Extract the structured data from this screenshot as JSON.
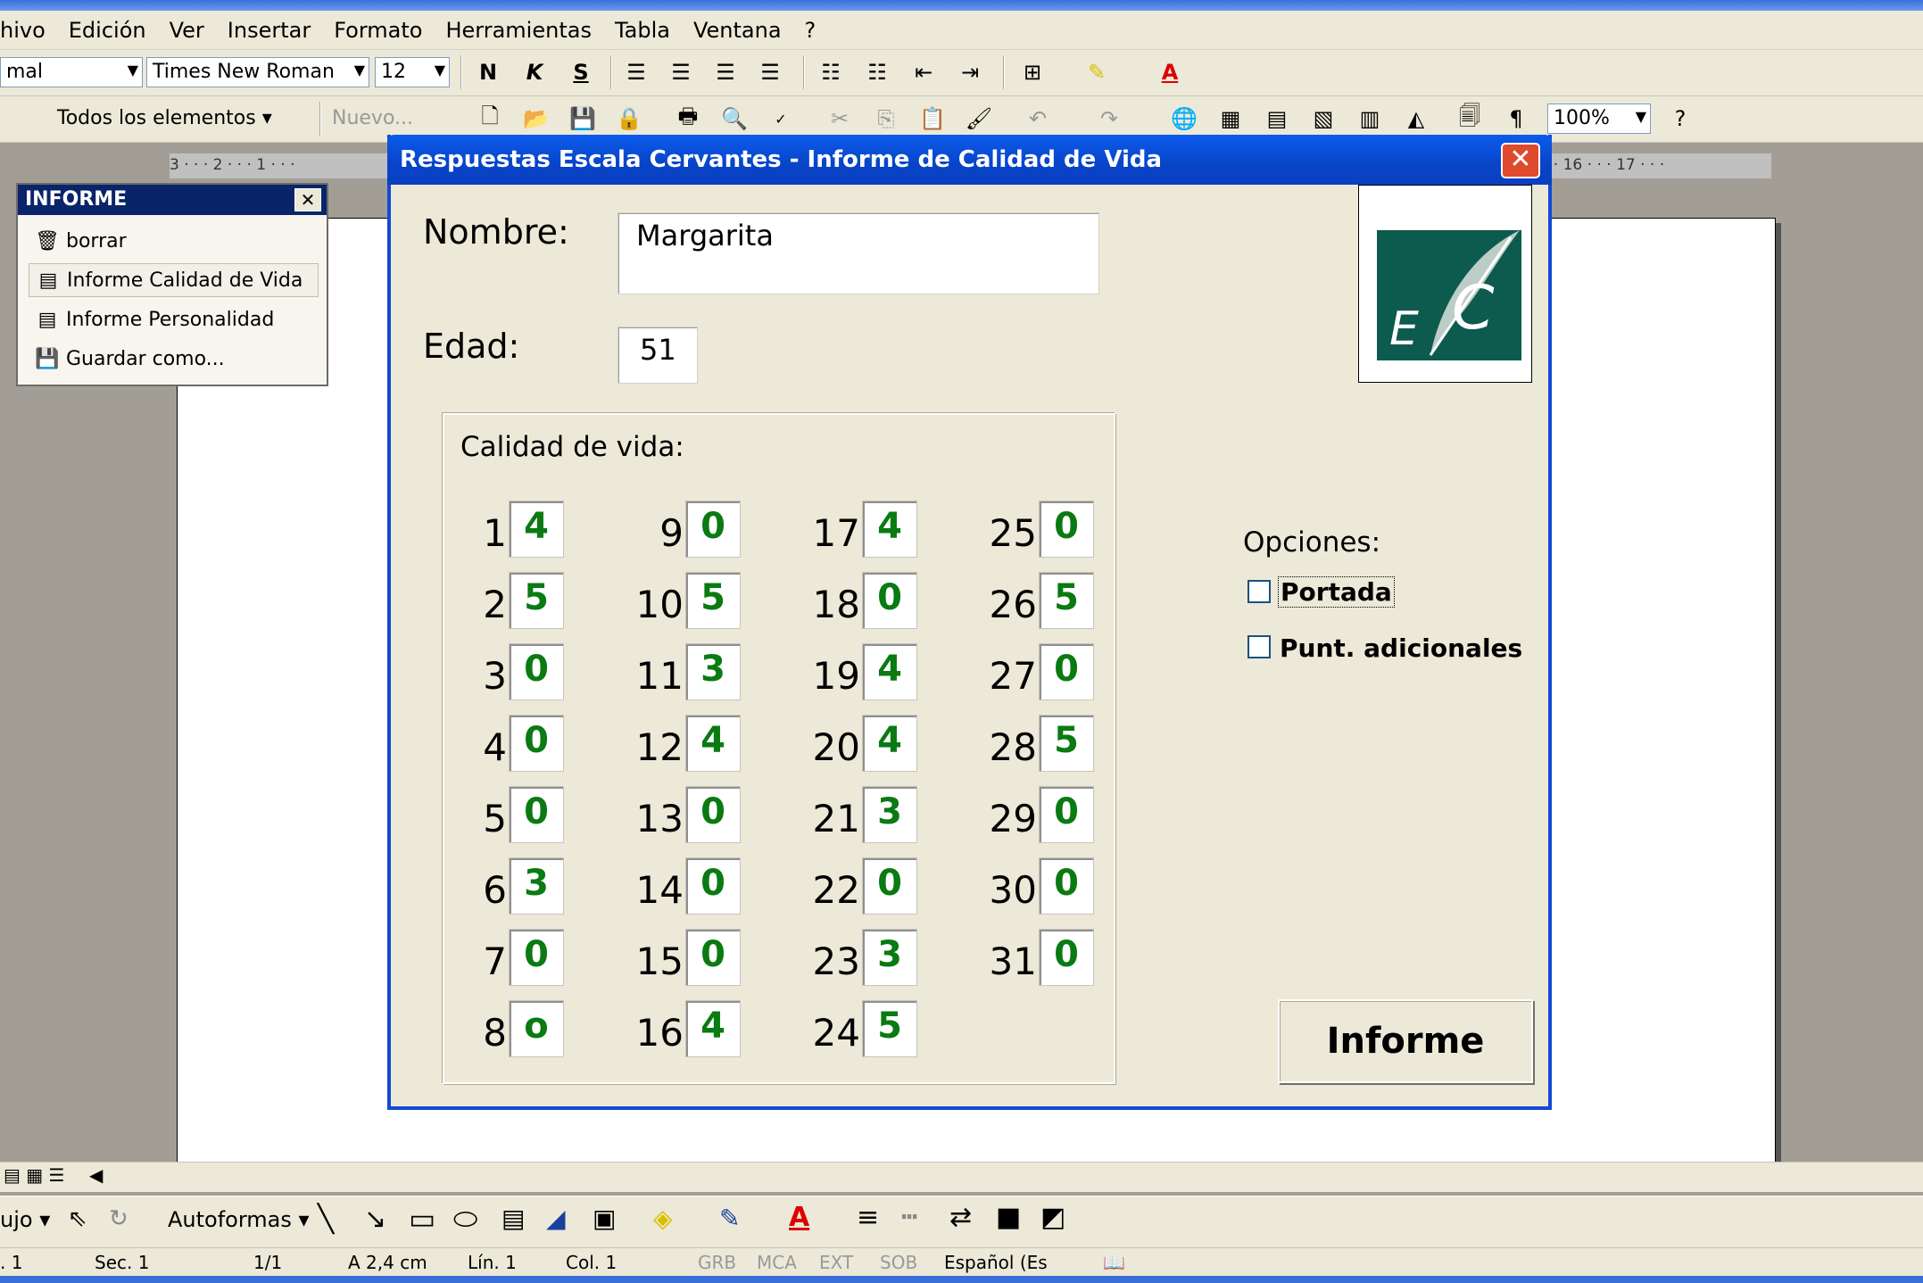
{
  "menubar": [
    "hivo",
    "Edición",
    "Ver",
    "Insertar",
    "Formato",
    "Herramientas",
    "Tabla",
    "Ventana",
    "?"
  ],
  "toolbar1": {
    "style": "mal",
    "font": "Times New Roman",
    "size": "12"
  },
  "toolbar2": {
    "elements": "Todos los elementos ▾",
    "nuevo": "Nuevo...",
    "zoom": "100%"
  },
  "ruler": {
    "left": "3 · · · 2 · · · 1 · · ·",
    "right": "· · 16 · · · 17 · · ·"
  },
  "informe_panel": {
    "title": "INFORME",
    "items": [
      {
        "label": "borrar",
        "icon": "trash-icon"
      },
      {
        "label": "Informe Calidad de Vida",
        "icon": "form-icon"
      },
      {
        "label": "Informe Personalidad",
        "icon": "form-icon"
      },
      {
        "label": "Guardar como...",
        "icon": "save-icon"
      }
    ]
  },
  "dialog": {
    "title": "Respuestas Escala Cervantes - Informe de Calidad de Vida",
    "nombre_label": "Nombre:",
    "nombre_value": "Margarita",
    "edad_label": "Edad:",
    "edad_value": "51",
    "logo_text": "E/C",
    "frame_label": "Calidad de vida:",
    "responses": [
      {
        "n": "1",
        "v": "4"
      },
      {
        "n": "2",
        "v": "5"
      },
      {
        "n": "3",
        "v": "0"
      },
      {
        "n": "4",
        "v": "0"
      },
      {
        "n": "5",
        "v": "0"
      },
      {
        "n": "6",
        "v": "3"
      },
      {
        "n": "7",
        "v": "0"
      },
      {
        "n": "8",
        "v": "o"
      },
      {
        "n": "9",
        "v": "0"
      },
      {
        "n": "10",
        "v": "5"
      },
      {
        "n": "11",
        "v": "3"
      },
      {
        "n": "12",
        "v": "4"
      },
      {
        "n": "13",
        "v": "0"
      },
      {
        "n": "14",
        "v": "0"
      },
      {
        "n": "15",
        "v": "0"
      },
      {
        "n": "16",
        "v": "4"
      },
      {
        "n": "17",
        "v": "4"
      },
      {
        "n": "18",
        "v": "0"
      },
      {
        "n": "19",
        "v": "4"
      },
      {
        "n": "20",
        "v": "4"
      },
      {
        "n": "21",
        "v": "3"
      },
      {
        "n": "22",
        "v": "0"
      },
      {
        "n": "23",
        "v": "3"
      },
      {
        "n": "24",
        "v": "5"
      },
      {
        "n": "25",
        "v": "0"
      },
      {
        "n": "26",
        "v": "5"
      },
      {
        "n": "27",
        "v": "0"
      },
      {
        "n": "28",
        "v": "5"
      },
      {
        "n": "29",
        "v": "0"
      },
      {
        "n": "30",
        "v": "0"
      },
      {
        "n": "31",
        "v": "0"
      }
    ],
    "opciones_label": "Opciones:",
    "portada_label": "Portada",
    "portada_checked": false,
    "punt_label": "Punt. adicionales",
    "punt_checked": false,
    "informe_button": "Informe"
  },
  "drawbar": {
    "dibujo": "ujo ▾",
    "autoformas": "Autoformas ▾"
  },
  "statusbar": {
    "pag": ". 1",
    "sec": "Sec. 1",
    "pages": "1/1",
    "at": "A 2,4 cm",
    "lin": "Lín. 1",
    "col": "Col. 1",
    "grb": "GRB",
    "mca": "MCA",
    "ext": "EXT",
    "sob": "SOB",
    "lang": "Español (Es"
  },
  "colors": {
    "answer_green": "#0a7a12",
    "title_blue": "#0844c8",
    "close_red": "#e04a2c",
    "logo_green": "#0d5a4e"
  }
}
